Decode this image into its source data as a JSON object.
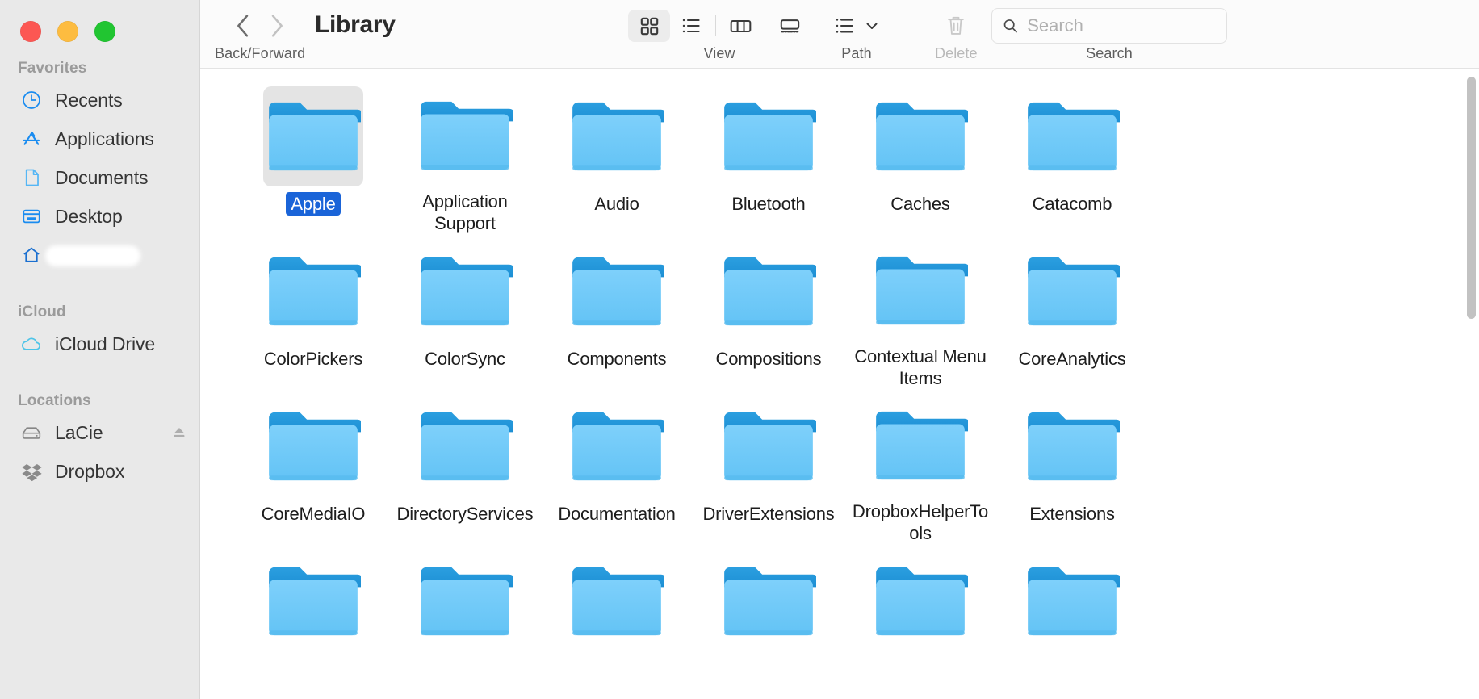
{
  "window": {
    "title": "Library",
    "traffic_lights": [
      {
        "name": "close",
        "color": "#fc5753"
      },
      {
        "name": "minimize",
        "color": "#fdbc40"
      },
      {
        "name": "zoom",
        "color": "#21c531"
      }
    ]
  },
  "toolbar": {
    "nav": {
      "back_icon": "chevron-left",
      "forward_icon": "chevron-right",
      "caption": "Back/Forward"
    },
    "view": {
      "caption": "View",
      "buttons": [
        {
          "name": "icon-view",
          "icon": "grid",
          "active": true
        },
        {
          "name": "list-view",
          "icon": "list",
          "active": false
        },
        {
          "name": "column-view",
          "icon": "columns",
          "active": false
        },
        {
          "name": "gallery-view",
          "icon": "gallery",
          "active": false
        }
      ]
    },
    "path": {
      "caption": "Path",
      "icon": "path-list",
      "chevron": "chevron-down"
    },
    "delete": {
      "caption": "Delete",
      "icon": "trash",
      "enabled": false
    },
    "search": {
      "caption": "Search",
      "placeholder": "Search",
      "value": "",
      "icon": "magnifier"
    }
  },
  "sidebar": {
    "sections": [
      {
        "header": "Favorites",
        "items": [
          {
            "label": "Recents",
            "icon": "clock-icon",
            "redacted": false
          },
          {
            "label": "Applications",
            "icon": "applications-icon",
            "redacted": false
          },
          {
            "label": "Documents",
            "icon": "document-icon",
            "redacted": false
          },
          {
            "label": "Desktop",
            "icon": "desktop-icon",
            "redacted": false
          },
          {
            "label": "",
            "icon": "home-icon",
            "redacted": true
          }
        ]
      },
      {
        "header": "iCloud",
        "items": [
          {
            "label": "iCloud Drive",
            "icon": "cloud-icon",
            "redacted": false
          }
        ]
      },
      {
        "header": "Locations",
        "items": [
          {
            "label": "LaCie",
            "icon": "harddisk-icon",
            "redacted": false,
            "eject": true
          },
          {
            "label": "Dropbox",
            "icon": "dropbox-icon",
            "redacted": false
          }
        ]
      }
    ]
  },
  "files": [
    {
      "name": "Apple",
      "kind": "folder",
      "selected": true
    },
    {
      "name": "Application Support",
      "kind": "folder",
      "selected": false
    },
    {
      "name": "Audio",
      "kind": "folder",
      "selected": false
    },
    {
      "name": "Bluetooth",
      "kind": "folder",
      "selected": false
    },
    {
      "name": "Caches",
      "kind": "folder",
      "selected": false
    },
    {
      "name": "Catacomb",
      "kind": "folder",
      "selected": false
    },
    {
      "name": "ColorPickers",
      "kind": "folder",
      "selected": false
    },
    {
      "name": "ColorSync",
      "kind": "folder",
      "selected": false
    },
    {
      "name": "Components",
      "kind": "folder",
      "selected": false
    },
    {
      "name": "Compositions",
      "kind": "folder",
      "selected": false
    },
    {
      "name": "Contextual Menu Items",
      "kind": "folder",
      "selected": false
    },
    {
      "name": "CoreAnalytics",
      "kind": "folder",
      "selected": false
    },
    {
      "name": "CoreMediaIO",
      "kind": "folder",
      "selected": false
    },
    {
      "name": "DirectoryServices",
      "kind": "folder",
      "selected": false
    },
    {
      "name": "Documentation",
      "kind": "folder",
      "selected": false
    },
    {
      "name": "DriverExtensions",
      "kind": "folder",
      "selected": false
    },
    {
      "name": "DropboxHelperTools",
      "kind": "folder",
      "selected": false
    },
    {
      "name": "Extensions",
      "kind": "folder",
      "selected": false
    },
    {
      "name": "",
      "kind": "folder",
      "selected": false
    },
    {
      "name": "",
      "kind": "folder",
      "selected": false
    },
    {
      "name": "",
      "kind": "folder",
      "selected": false
    },
    {
      "name": "",
      "kind": "folder",
      "selected": false
    },
    {
      "name": "",
      "kind": "folder",
      "selected": false
    },
    {
      "name": "",
      "kind": "folder",
      "selected": false
    }
  ],
  "colors": {
    "folder_body": "#6fc9f7",
    "folder_tab": "#2196d9",
    "selection_blue": "#1a64d8",
    "sidebar_bg": "#e9e9e9",
    "toolbar_bg": "#fbfbfb"
  }
}
